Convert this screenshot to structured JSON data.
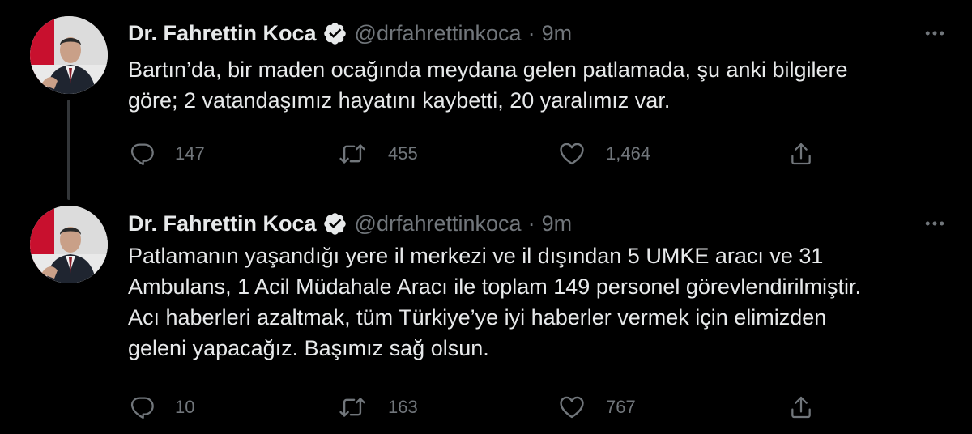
{
  "colors": {
    "background": "#000000",
    "primary_text": "#e7e9ea",
    "secondary_text": "#71767b",
    "verified_badge": "#e7e9ea",
    "thread_line": "#333639"
  },
  "tweets": [
    {
      "author": {
        "display_name": "Dr. Fahrettin Koca",
        "handle": "@drfahrettinkoca",
        "verified_icon": "verified-badge-icon"
      },
      "separator": "·",
      "time": "9m",
      "text_lines": [
        "Bartın’da, bir maden ocağında meydana gelen patlamada, şu anki bilgilere",
        "göre; 2 vatandaşımız hayatını kaybetti, 20 yaralımız var."
      ],
      "actions": {
        "reply": {
          "icon": "reply-icon",
          "count": "147"
        },
        "retweet": {
          "icon": "retweet-icon",
          "count": "455"
        },
        "like": {
          "icon": "heart-icon",
          "count": "1,464"
        },
        "share": {
          "icon": "share-icon"
        }
      }
    },
    {
      "author": {
        "display_name": "Dr. Fahrettin Koca",
        "handle": "@drfahrettinkoca",
        "verified_icon": "verified-badge-icon"
      },
      "separator": "·",
      "time": "9m",
      "text_lines": [
        "Patlamanın yaşandığı yere il merkezi ve il dışından 5 UMKE aracı ve 31",
        "Ambulans, 1 Acil Müdahale Aracı ile toplam 149 personel görevlendirilmiştir.",
        "Acı haberleri azaltmak, tüm Türkiye’ye iyi haberler vermek için elimizden",
        "geleni yapacağız. Başımız sağ olsun."
      ],
      "actions": {
        "reply": {
          "icon": "reply-icon",
          "count": "10"
        },
        "retweet": {
          "icon": "retweet-icon",
          "count": "163"
        },
        "like": {
          "icon": "heart-icon",
          "count": "767"
        },
        "share": {
          "icon": "share-icon"
        }
      }
    }
  ]
}
